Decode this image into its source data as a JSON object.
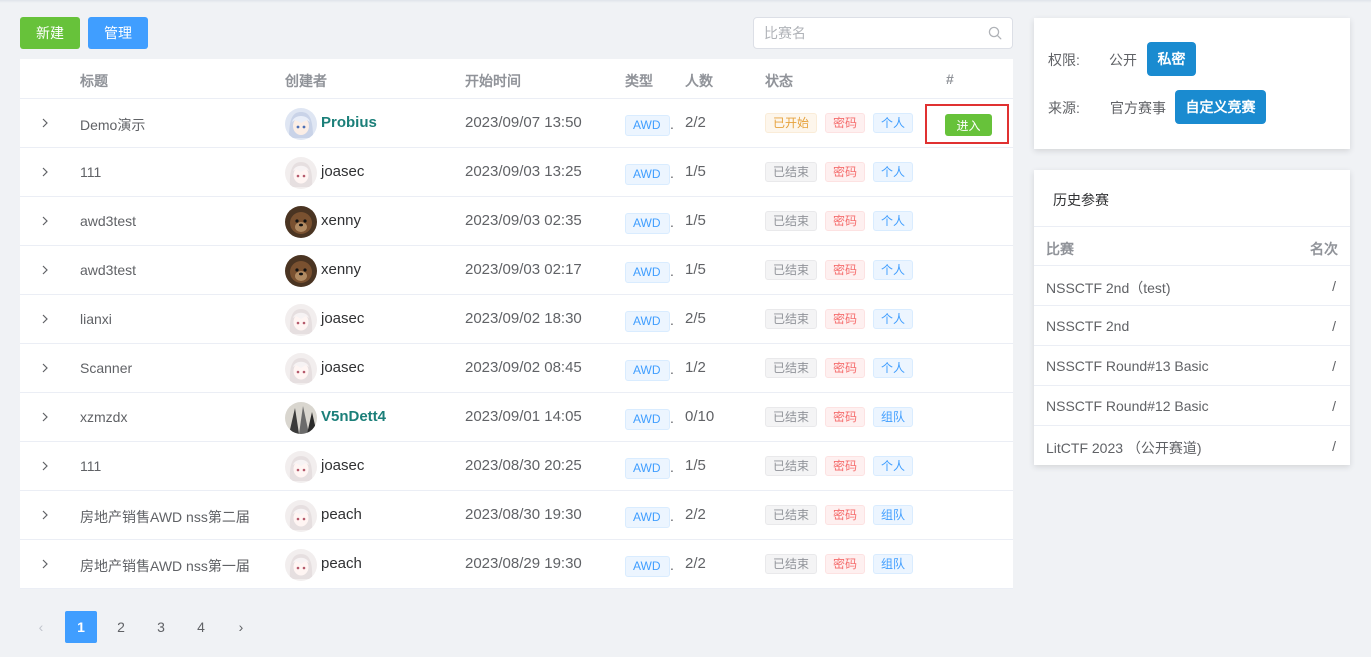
{
  "toolbar": {
    "new_label": "新建",
    "manage_label": "管理"
  },
  "search": {
    "placeholder": "比赛名",
    "value": ""
  },
  "table": {
    "headers": {
      "title": "标题",
      "creator": "创建者",
      "start_time": "开始时间",
      "type": "类型",
      "count": "人数",
      "status": "状态",
      "action": "#"
    },
    "rows": [
      {
        "title": "Demo演示",
        "creator": "Probius",
        "creator_bold": true,
        "avatar": "anime-silver",
        "time": "2023/09/07 13:50",
        "type": "AWD",
        "count": "2/2",
        "status": "已开始",
        "status_kind": "started",
        "pw": "密码",
        "mode": "个人",
        "action": "进入"
      },
      {
        "title": "111",
        "creator": "joasec",
        "creator_bold": false,
        "avatar": "anime-white",
        "time": "2023/09/03 13:25",
        "type": "AWD",
        "count": "1/5",
        "status": "已结束",
        "status_kind": "ended",
        "pw": "密码",
        "mode": "个人",
        "action": ""
      },
      {
        "title": "awd3test",
        "creator": "xenny",
        "creator_bold": false,
        "avatar": "dog-brown",
        "time": "2023/09/03 02:35",
        "type": "AWD",
        "count": "1/5",
        "status": "已结束",
        "status_kind": "ended",
        "pw": "密码",
        "mode": "个人",
        "action": ""
      },
      {
        "title": "awd3test",
        "creator": "xenny",
        "creator_bold": false,
        "avatar": "dog-brown",
        "time": "2023/09/03 02:17",
        "type": "AWD",
        "count": "1/5",
        "status": "已结束",
        "status_kind": "ended",
        "pw": "密码",
        "mode": "个人",
        "action": ""
      },
      {
        "title": "lianxi",
        "creator": "joasec",
        "creator_bold": false,
        "avatar": "anime-white",
        "time": "2023/09/02 18:30",
        "type": "AWD",
        "count": "2/5",
        "status": "已结束",
        "status_kind": "ended",
        "pw": "密码",
        "mode": "个人",
        "action": ""
      },
      {
        "title": "Scanner",
        "creator": "joasec",
        "creator_bold": false,
        "avatar": "anime-white",
        "time": "2023/09/02 08:45",
        "type": "AWD",
        "count": "1/2",
        "status": "已结束",
        "status_kind": "ended",
        "pw": "密码",
        "mode": "个人",
        "action": ""
      },
      {
        "title": "xzmzdx",
        "creator": "V5nDett4",
        "creator_bold": true,
        "avatar": "photo-dark",
        "time": "2023/09/01 14:05",
        "type": "AWD",
        "count": "0/10",
        "status": "已结束",
        "status_kind": "ended",
        "pw": "密码",
        "mode": "组队",
        "action": ""
      },
      {
        "title": "111",
        "creator": "joasec",
        "creator_bold": false,
        "avatar": "anime-white",
        "time": "2023/08/30 20:25",
        "type": "AWD",
        "count": "1/5",
        "status": "已结束",
        "status_kind": "ended",
        "pw": "密码",
        "mode": "个人",
        "action": ""
      },
      {
        "title": "房地产销售AWD nss第二届",
        "creator": "peach",
        "creator_bold": false,
        "avatar": "anime-white",
        "time": "2023/08/30 19:30",
        "type": "AWD",
        "count": "2/2",
        "status": "已结束",
        "status_kind": "ended",
        "pw": "密码",
        "mode": "组队",
        "action": ""
      },
      {
        "title": "房地产销售AWD nss第一届",
        "creator": "peach",
        "creator_bold": false,
        "avatar": "anime-white",
        "time": "2023/08/29 19:30",
        "type": "AWD",
        "count": "2/2",
        "status": "已结束",
        "status_kind": "ended",
        "pw": "密码",
        "mode": "组队",
        "action": ""
      }
    ]
  },
  "pagination": {
    "prev": "‹",
    "next": "›",
    "pages": [
      "1",
      "2",
      "3",
      "4"
    ],
    "current": "1"
  },
  "filter": {
    "permission_label": "权限:",
    "permission_options": [
      "公开",
      "私密"
    ],
    "permission_selected": "私密",
    "source_label": "来源:",
    "source_options": [
      "官方赛事",
      "自定义竞赛"
    ],
    "source_selected": "自定义竞赛"
  },
  "history": {
    "title": "历史参赛",
    "col_match": "比赛",
    "col_rank": "名次",
    "rows": [
      {
        "name": "NSSCTF 2nd（test)",
        "rank": "/"
      },
      {
        "name": "NSSCTF 2nd",
        "rank": "/"
      },
      {
        "name": "NSSCTF Round#13 Basic",
        "rank": "/"
      },
      {
        "name": "NSSCTF Round#12 Basic",
        "rank": "/"
      },
      {
        "name": "LitCTF 2023 （公开赛道)",
        "rank": "/"
      }
    ]
  },
  "colors": {
    "primary": "#409eff",
    "success": "#67c23a",
    "danger": "#f56c6c",
    "warning": "#e6a23c",
    "filter_active": "#1a8bd0"
  }
}
